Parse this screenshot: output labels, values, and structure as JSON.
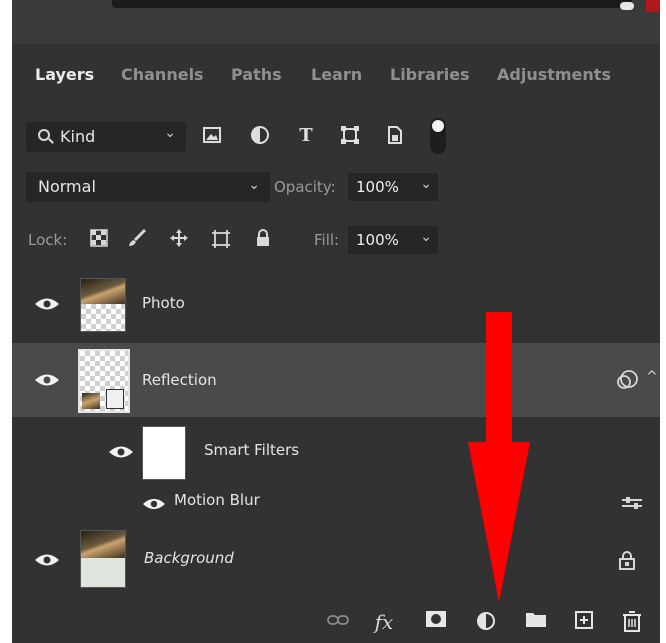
{
  "tabs": [
    "Layers",
    "Channels",
    "Paths",
    "Learn",
    "Libraries",
    "Adjustments"
  ],
  "filter": {
    "label": "Kind",
    "icons": [
      "image-icon",
      "adjustment-circle-icon",
      "type-icon",
      "shape-icon",
      "smart-object-icon"
    ]
  },
  "blend": {
    "mode": "Normal",
    "opacity_label": "Opacity:",
    "opacity": "100%"
  },
  "lock": {
    "label": "Lock:",
    "fill_label": "Fill:",
    "fill": "100%"
  },
  "layers": [
    {
      "name": "Photo"
    },
    {
      "name": "Reflection"
    },
    {
      "name": "Smart Filters"
    },
    {
      "name": "Motion Blur"
    },
    {
      "name": "Background"
    }
  ],
  "footer_icons": [
    "link-icon",
    "fx-icon",
    "mask-icon",
    "adjustment-layer-icon",
    "folder-icon",
    "new-layer-icon",
    "trash-icon"
  ],
  "annotation": {
    "arrow_color": "#ff0000"
  },
  "colors": {
    "panel_bg": "#323232",
    "selected_row": "#4a4a4a"
  }
}
